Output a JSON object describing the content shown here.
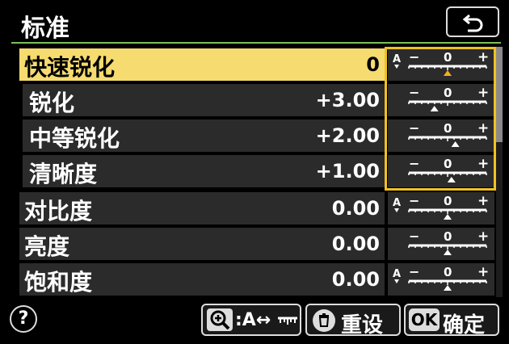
{
  "header": {
    "title": "标准"
  },
  "items": [
    {
      "label": "快速锐化",
      "value": "0",
      "auto": true,
      "level": 0.5
    },
    {
      "label": "锐化",
      "value": "+3.00",
      "auto": false,
      "level": 0.33
    },
    {
      "label": "中等锐化",
      "value": "+2.00",
      "auto": false,
      "level": 0.6
    },
    {
      "label": "清晰度",
      "value": "+1.00",
      "auto": false,
      "level": 0.55
    },
    {
      "label": "对比度",
      "value": "0.00",
      "auto": true,
      "level": 0.5
    },
    {
      "label": "亮度",
      "value": "0.00",
      "auto": false,
      "level": 0.5
    },
    {
      "label": "饱和度",
      "value": "0.00",
      "auto": true,
      "level": 0.5
    }
  ],
  "gauge": {
    "minus": "−",
    "zero": "0",
    "plus": "+",
    "auto_mark": "A"
  },
  "footer": {
    "help": "?",
    "zoom_label": ":A↔",
    "reset_label": "重设",
    "ok_badge": "OK",
    "ok_label": "确定"
  },
  "colors": {
    "selection": "#f5db70",
    "frame": "#f0c024",
    "accent_line": "#7cc05a",
    "indicator_selected": "#f0b020"
  }
}
